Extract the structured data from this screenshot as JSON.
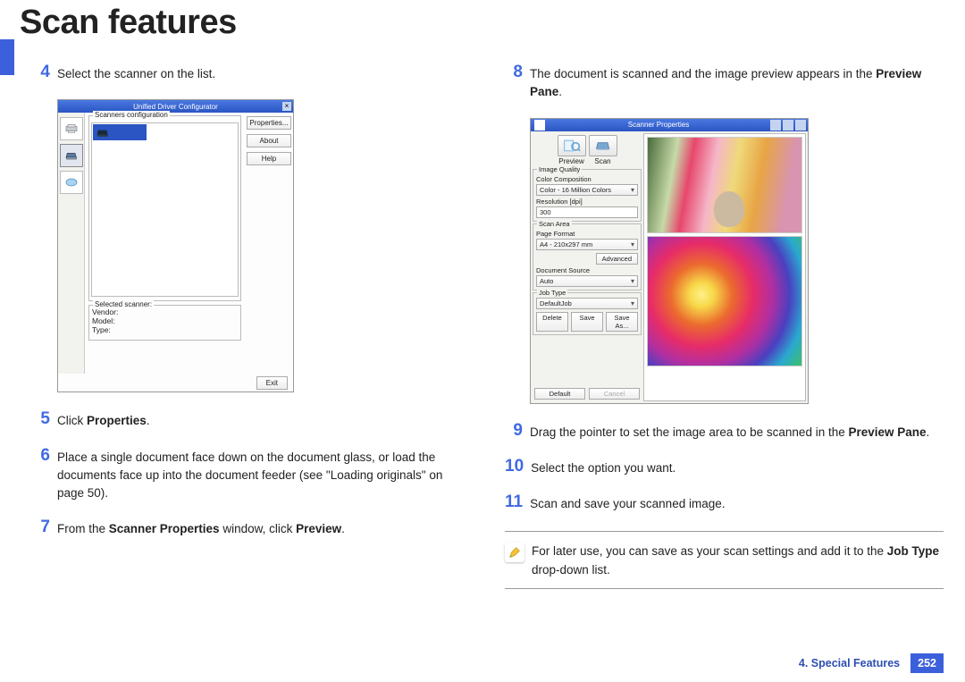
{
  "title": "Scan features",
  "left": {
    "step4": {
      "num": "4",
      "text": "Select the scanner on the list."
    },
    "step5": {
      "num": "5",
      "pre": "Click ",
      "bold": "Properties",
      "post": "."
    },
    "step6": {
      "num": "6",
      "text": "Place a single document face down on the document glass, or load the documents face up into the document feeder (see \"Loading originals\" on page 50)."
    },
    "step7": {
      "num": "7",
      "pre": "From the ",
      "bold1": "Scanner Properties",
      "mid": " window, click ",
      "bold2": "Preview",
      "post": "."
    }
  },
  "right": {
    "step8": {
      "num": "8",
      "pre": "The document is scanned and the image preview appears in the ",
      "bold": "Preview Pane",
      "post": "."
    },
    "step9": {
      "num": "9",
      "pre": "Drag the pointer to set the image area to be scanned in the ",
      "bold": "Preview Pane",
      "post": "."
    },
    "step10": {
      "num": "10",
      "text": "Select the option you want."
    },
    "step11": {
      "num": "11",
      "text": "Scan and save your scanned image."
    },
    "note": {
      "pre": "For later use, you can save as your scan settings and add it to the ",
      "bold": "Job Type",
      "post": " drop-down list."
    }
  },
  "shots": {
    "driver": {
      "title": "Unified Driver Configurator",
      "group": "Scanners configuration",
      "btns": {
        "properties": "Properties...",
        "about": "About",
        "help": "Help"
      },
      "sel_label": "Selected scanner:",
      "vendor": "Vendor:",
      "model": "Model:",
      "type": "Type:",
      "exit": "Exit"
    },
    "scanprop": {
      "title": "Scanner Properties",
      "preview": "Preview",
      "scan": "Scan",
      "iq_group": "Image Quality",
      "cc_label": "Color Composition",
      "cc_value": "Color - 16 Million Colors",
      "res_label": "Resolution [dpi]",
      "res_value": "300",
      "sa_group": "Scan Area",
      "pf_label": "Page Format",
      "pf_value": "A4 - 210x297 mm",
      "advanced": "Advanced",
      "ds_label": "Document Source",
      "ds_value": "Auto",
      "jt_group": "Job Type",
      "jt_value": "DefaultJob",
      "delete": "Delete",
      "save": "Save",
      "saveas": "Save As...",
      "default": "Default",
      "cancel": "Cancel"
    }
  },
  "footer": {
    "chapter": "4.  Special Features",
    "page": "252"
  }
}
